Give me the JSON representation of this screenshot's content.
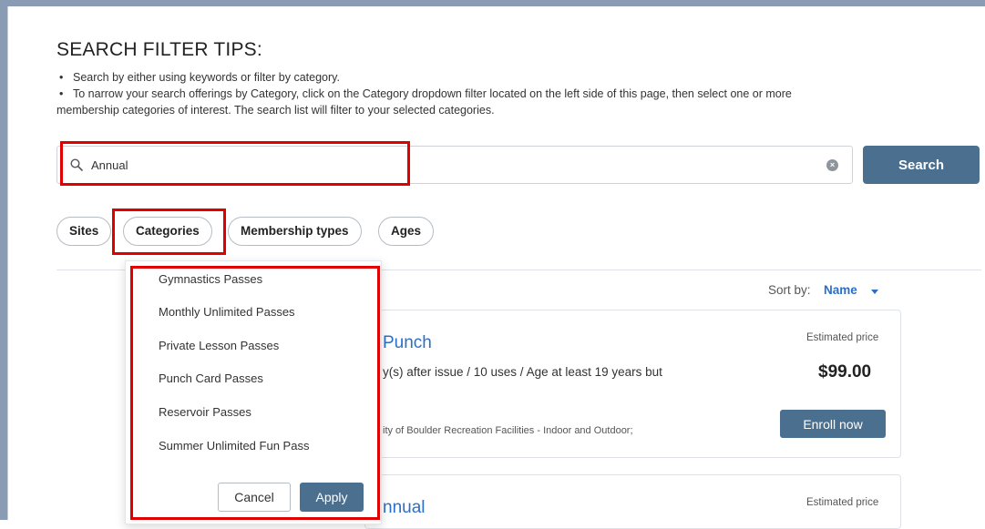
{
  "page_title": "SEARCH FILTER TIPS:",
  "tips": {
    "bullet": "•",
    "tip1": "Search by either using keywords or filter by category.",
    "tip2_line1": "To narrow your search offerings by Category, click on the Category dropdown filter located on the left side of this page, then select one or more",
    "tip2_line2": "membership categories of interest. The search list will filter to your selected categories."
  },
  "search": {
    "value": "Annual",
    "button_label": "Search",
    "clear_glyph": "×"
  },
  "filters": {
    "sites": "Sites",
    "categories": "Categories",
    "membership_types": "Membership types",
    "ages": "Ages"
  },
  "sort": {
    "label": "Sort by:",
    "value": "Name"
  },
  "results": [
    {
      "title": "Punch",
      "estimated_label": "Estimated price",
      "price": "$99.00",
      "desc": "y(s) after issue / 10 uses / Age at least 19 years but",
      "location": "ity of Boulder Recreation Facilities - Indoor and Outdoor;",
      "enroll_label": "Enroll now"
    },
    {
      "title": "nnual",
      "estimated_label": "Estimated price"
    }
  ],
  "category_dropdown": {
    "options": [
      "Gymnastics Passes",
      "Monthly Unlimited Passes",
      "Private Lesson Passes",
      "Punch Card Passes",
      "Reservoir Passes",
      "Summer Unlimited Fun Pass"
    ],
    "cancel_label": "Cancel",
    "apply_label": "Apply"
  },
  "colors": {
    "accent": "#4a6f8f",
    "link": "#2a6fc9",
    "highlight": "#e00000"
  }
}
